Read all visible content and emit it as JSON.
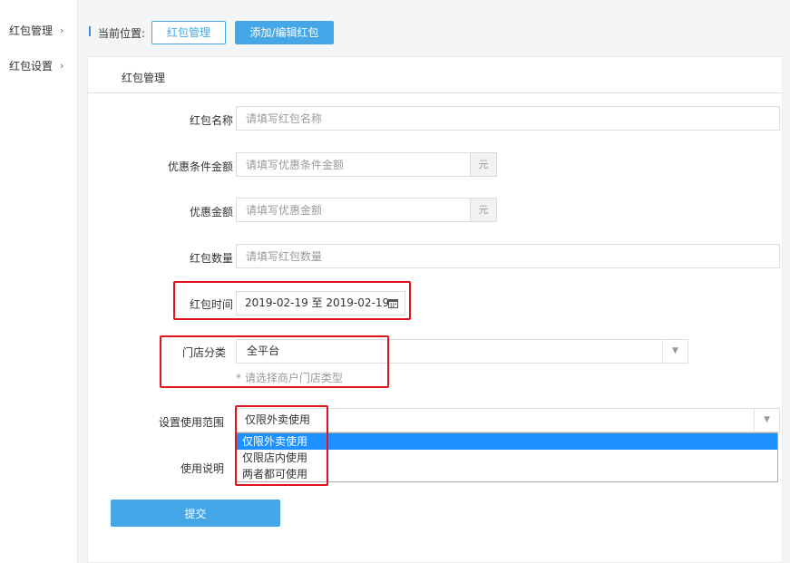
{
  "sidebar": {
    "items": [
      {
        "label": "红包管理"
      },
      {
        "label": "红包设置"
      }
    ]
  },
  "breadcrumb": {
    "label": "当前位置:",
    "buttons": [
      {
        "label": "红包管理"
      },
      {
        "label": "添加/编辑红包"
      }
    ]
  },
  "panel": {
    "title": "红包管理"
  },
  "form": {
    "name": {
      "label": "红包名称",
      "placeholder": "请填写红包名称"
    },
    "condition_amount": {
      "label": "优惠条件金额",
      "placeholder": "请填写优惠条件金额",
      "unit": "元"
    },
    "discount_amount": {
      "label": "优惠金额",
      "placeholder": "请填写优惠金额",
      "unit": "元"
    },
    "quantity": {
      "label": "红包数量",
      "placeholder": "请填写红包数量"
    },
    "time": {
      "label": "红包时间",
      "value": "2019-02-19 至 2019-02-19"
    },
    "store_category": {
      "label": "门店分类",
      "value": "全平台",
      "hint": "* 请选择商户门店类型"
    },
    "usage_scope": {
      "label": "设置使用范围",
      "value": "仅限外卖使用",
      "options": [
        "仅限外卖使用",
        "仅限店内使用",
        "两者都可使用"
      ],
      "selected_index": 0
    },
    "usage_note": {
      "label": "使用说明"
    },
    "submit_label": "提交"
  },
  "colors": {
    "accent": "#45a7e8",
    "highlight": "#e0141e",
    "option_selected": "#1e90ff"
  }
}
